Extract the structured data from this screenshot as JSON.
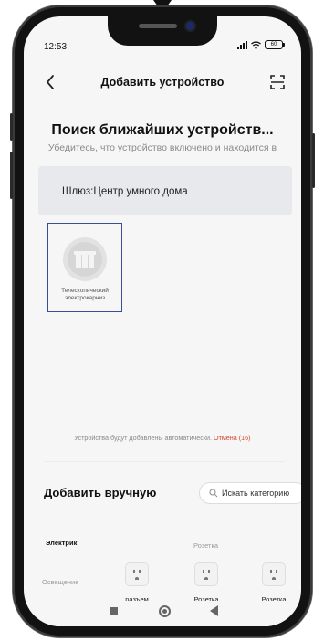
{
  "status_bar": {
    "time": "12:53",
    "battery": "60"
  },
  "header": {
    "title": "Добавить устройство",
    "back_icon": "chevron-left-icon",
    "scan_icon": "scan-icon"
  },
  "search": {
    "title": "Поиск ближайших устройств...",
    "subtitle": "Убедитесь, что устройство включено и находится в"
  },
  "gateway": {
    "label": "Шлюз:Центр умного дома"
  },
  "found_devices": [
    {
      "name": "Телескопический электрокарниз",
      "icon": "curtain-motor-icon"
    }
  ],
  "auto_add": {
    "text": "Устройства будут добавлены автоматически.",
    "cancel": "Отмена (16)"
  },
  "manual": {
    "title": "Добавить вручную",
    "search_placeholder": "Искать категорию",
    "categories": [
      {
        "label": "Электрик",
        "active": true
      },
      {
        "label": "Освещение",
        "active": false
      }
    ],
    "group_title": "Розетка",
    "devices": [
      {
        "label": "разъем",
        "icon": "socket-icon"
      },
      {
        "label": "Розетка",
        "icon": "socket-icon"
      },
      {
        "label": "Розетка",
        "icon": "socket-icon"
      }
    ]
  },
  "colors": {
    "accent_cancel": "#d9422c",
    "selection_border": "#3a4e96",
    "gateway_bg": "#e8e9ed"
  }
}
